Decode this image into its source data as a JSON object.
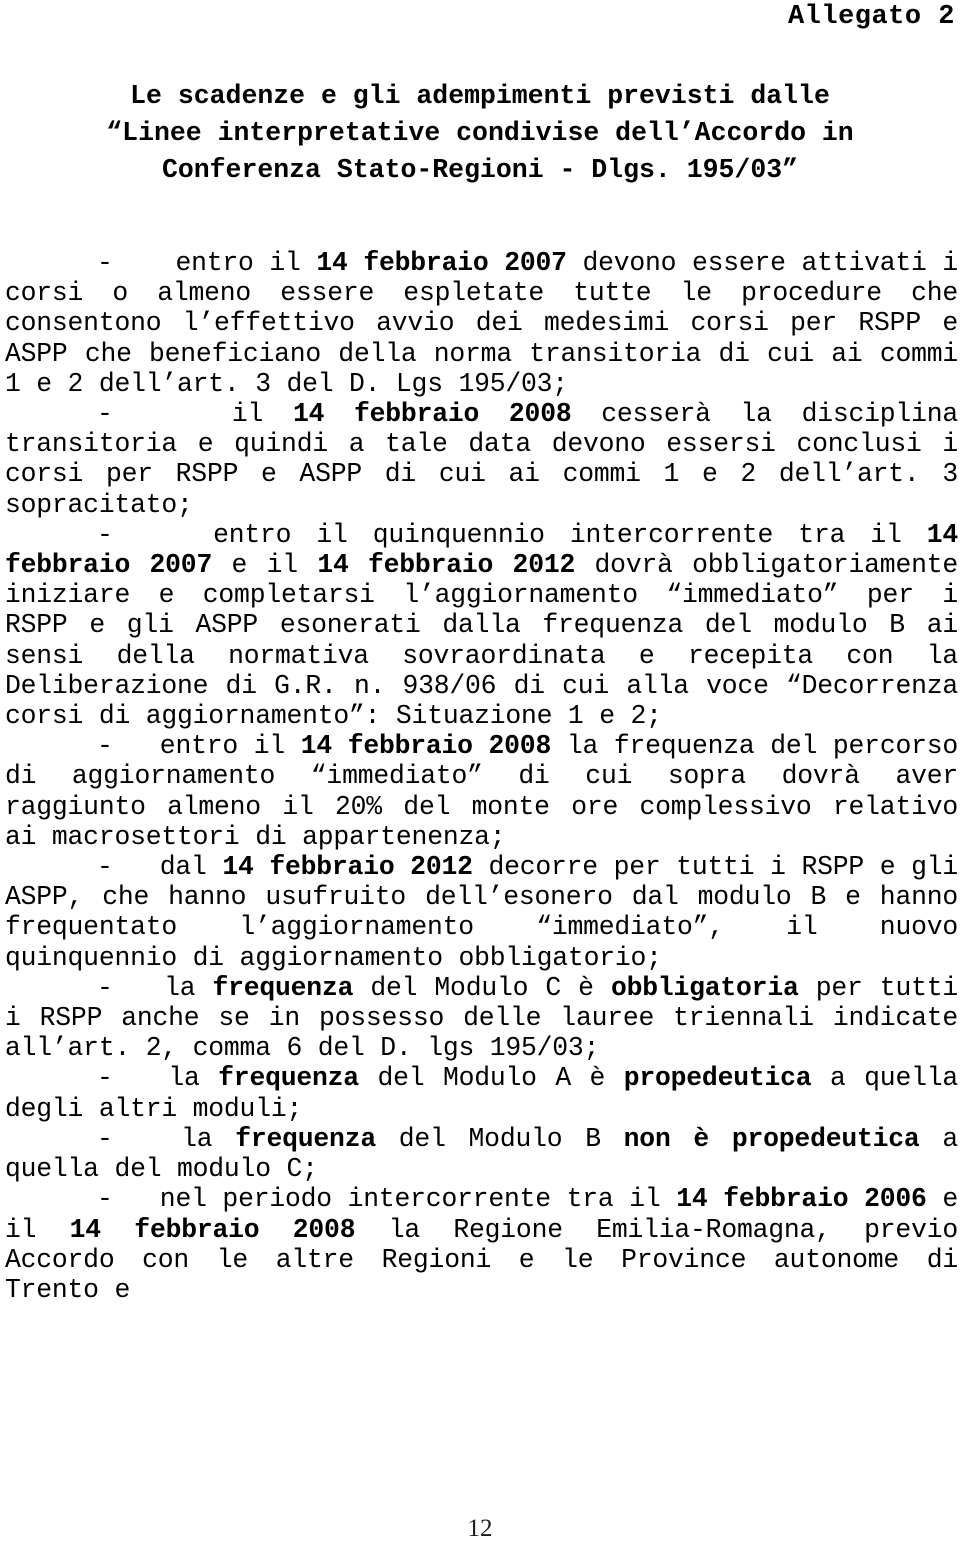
{
  "document": {
    "annex_label": "Allegato 2",
    "title_lines": [
      "Le scadenze e gli adempimenti previsti dalle",
      "“Linee interpretative condivise dell’Accordo in",
      "Conferenza Stato-Regioni - Dlgs. 195/03”"
    ],
    "page_number": "12",
    "paragraphs": [
      {
        "id": "para-1",
        "marker": "-",
        "runs": [
          {
            "text": "-    entro il ",
            "bold": false
          },
          {
            "text": "14 febbraio 2007",
            "bold": true
          },
          {
            "text": " devono essere attivati i corsi o almeno essere espletate tutte le procedure che consentono l’effettivo avvio dei medesimi corsi per RSPP e ASPP che beneficiano della norma transitoria di cui ai commi 1 e 2 dell’art. 3 del D. Lgs 195/03;",
            "bold": false
          }
        ]
      },
      {
        "id": "para-2",
        "marker": "-",
        "runs": [
          {
            "text": "-    il ",
            "bold": false
          },
          {
            "text": "14 febbraio 2008",
            "bold": true
          },
          {
            "text": " cesserà la disciplina transitoria e quindi a tale data devono essersi conclusi i corsi per RSPP e ASPP di cui ai commi 1 e 2 dell’art. 3 sopracitato;",
            "bold": false
          }
        ]
      },
      {
        "id": "para-3",
        "marker": "-",
        "runs": [
          {
            "text": "-    entro il quinquennio intercorrente tra il ",
            "bold": false
          },
          {
            "text": "14 febbraio 2007",
            "bold": true
          },
          {
            "text": " e il ",
            "bold": false
          },
          {
            "text": "14 febbraio 2012",
            "bold": true
          },
          {
            "text": " dovrà obbligatoriamente iniziare e completarsi l’aggiornamento “immediato” per i RSPP e gli ASPP esonerati dalla frequenza del modulo B ai sensi della normativa sovraordinata e recepita con la Deliberazione di G.R. n. 938/06 di cui alla voce “Decorrenza corsi di aggiornamento”: Situazione 1 e 2;",
            "bold": false
          }
        ]
      },
      {
        "id": "para-4",
        "marker": "-",
        "runs": [
          {
            "text": "-   entro il ",
            "bold": false
          },
          {
            "text": "14 febbraio 2008",
            "bold": true
          },
          {
            "text": " la frequenza del percorso di aggiornamento “immediato” di cui sopra  dovrà aver raggiunto almeno il 20% del monte ore complessivo  relativo ai macrosettori di appartenenza;",
            "bold": false
          }
        ]
      },
      {
        "id": "para-5",
        "marker": "-",
        "runs": [
          {
            "text": "-   dal ",
            "bold": false
          },
          {
            "text": "14 febbraio 2012",
            "bold": true
          },
          {
            "text": " decorre per tutti i RSPP e gli ASPP, che hanno usufruito dell’esonero dal modulo B e hanno frequentato l’aggiornamento “immediato”, il nuovo quinquennio di aggiornamento obbligatorio;",
            "bold": false
          }
        ]
      },
      {
        "id": "para-6",
        "marker": "-",
        "runs": [
          {
            "text": "-   la ",
            "bold": false
          },
          {
            "text": "frequenza",
            "bold": true
          },
          {
            "text": " del Modulo C è ",
            "bold": false
          },
          {
            "text": "obbligatoria",
            "bold": true
          },
          {
            "text": " per tutti i RSPP anche se in possesso delle lauree triennali indicate all’art. 2, comma 6 del D. lgs 195/03;",
            "bold": false
          }
        ]
      },
      {
        "id": "para-7",
        "marker": "-",
        "runs": [
          {
            "text": "-   la ",
            "bold": false
          },
          {
            "text": "frequenza",
            "bold": true
          },
          {
            "text": " del Modulo A è ",
            "bold": false
          },
          {
            "text": "propedeutica",
            "bold": true
          },
          {
            "text": " a quella degli altri moduli;",
            "bold": false
          }
        ]
      },
      {
        "id": "para-8",
        "marker": "-",
        "runs": [
          {
            "text": "-   la ",
            "bold": false
          },
          {
            "text": "frequenza",
            "bold": true
          },
          {
            "text": " del Modulo B ",
            "bold": false
          },
          {
            "text": "non è propedeutica",
            "bold": true
          },
          {
            "text": " a quella del modulo C;",
            "bold": false
          }
        ]
      },
      {
        "id": "para-9",
        "marker": "-",
        "runs": [
          {
            "text": "-   nel periodo intercorrente tra il ",
            "bold": false
          },
          {
            "text": "14 febbraio 2006",
            "bold": true
          },
          {
            "text": " e il ",
            "bold": false
          },
          {
            "text": "14 febbraio 2008",
            "bold": true
          },
          {
            "text": " la Regione Emilia-Romagna, previo Accordo con le altre Regioni e le Province autonome di Trento e",
            "bold": false
          }
        ]
      }
    ]
  }
}
